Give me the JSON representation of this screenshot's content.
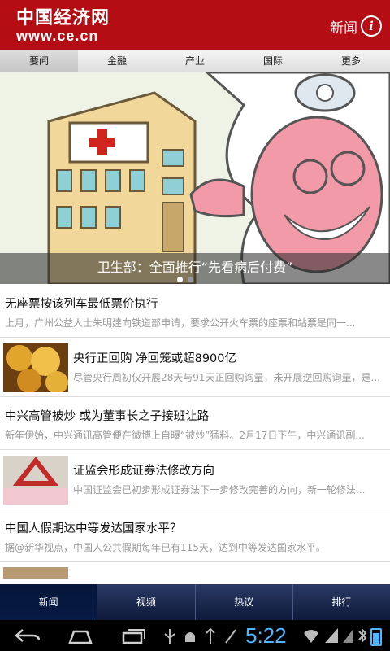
{
  "header": {
    "logo_cn": "中国经济网",
    "logo_url": "www.ce.cn",
    "title": "新闻",
    "info_icon": "info-icon"
  },
  "tabs": [
    "要闻",
    "金融",
    "产业",
    "国际",
    "更多"
  ],
  "banner": {
    "caption": "卫生部：全面推行“先看病后付费”",
    "dot_count": 2
  },
  "news": [
    {
      "title": "无座票按该列车最低票价执行",
      "summary": "上月，广州公益人士朱明建向铁道部申请，要求公开火车票的座票和站票是同一..."
    },
    {
      "title": "央行正回购 净回笼或超8900亿",
      "summary": "尽管央行周初仅开展28天与91天正回购询量，未开展逆回购询量，是..."
    },
    {
      "title": "中兴高管被炒 或为董事长之子接班让路",
      "summary": "新年伊始，中兴通讯高管便在微博上自曝“被炒”猛料。2月17日下午，中兴通讯副..."
    },
    {
      "title": "证监会形成证券法修改方向",
      "summary": "中国证监会已初步形成证券法下一步修改完善的方向，新一轮修法..."
    },
    {
      "title": "中国人假期达中等发达国家水平？",
      "summary": "据@新华视点，中国人公共假期每年已有115天，达到中等发达国家水平。"
    }
  ],
  "bottom_tabs": [
    "新闻",
    "视频",
    "热议",
    "排行"
  ],
  "system": {
    "clock": "5:22"
  },
  "colors": {
    "brand": "#b40d14",
    "nav_dark": "#0e1a3a",
    "clock": "#4fb6ff"
  }
}
